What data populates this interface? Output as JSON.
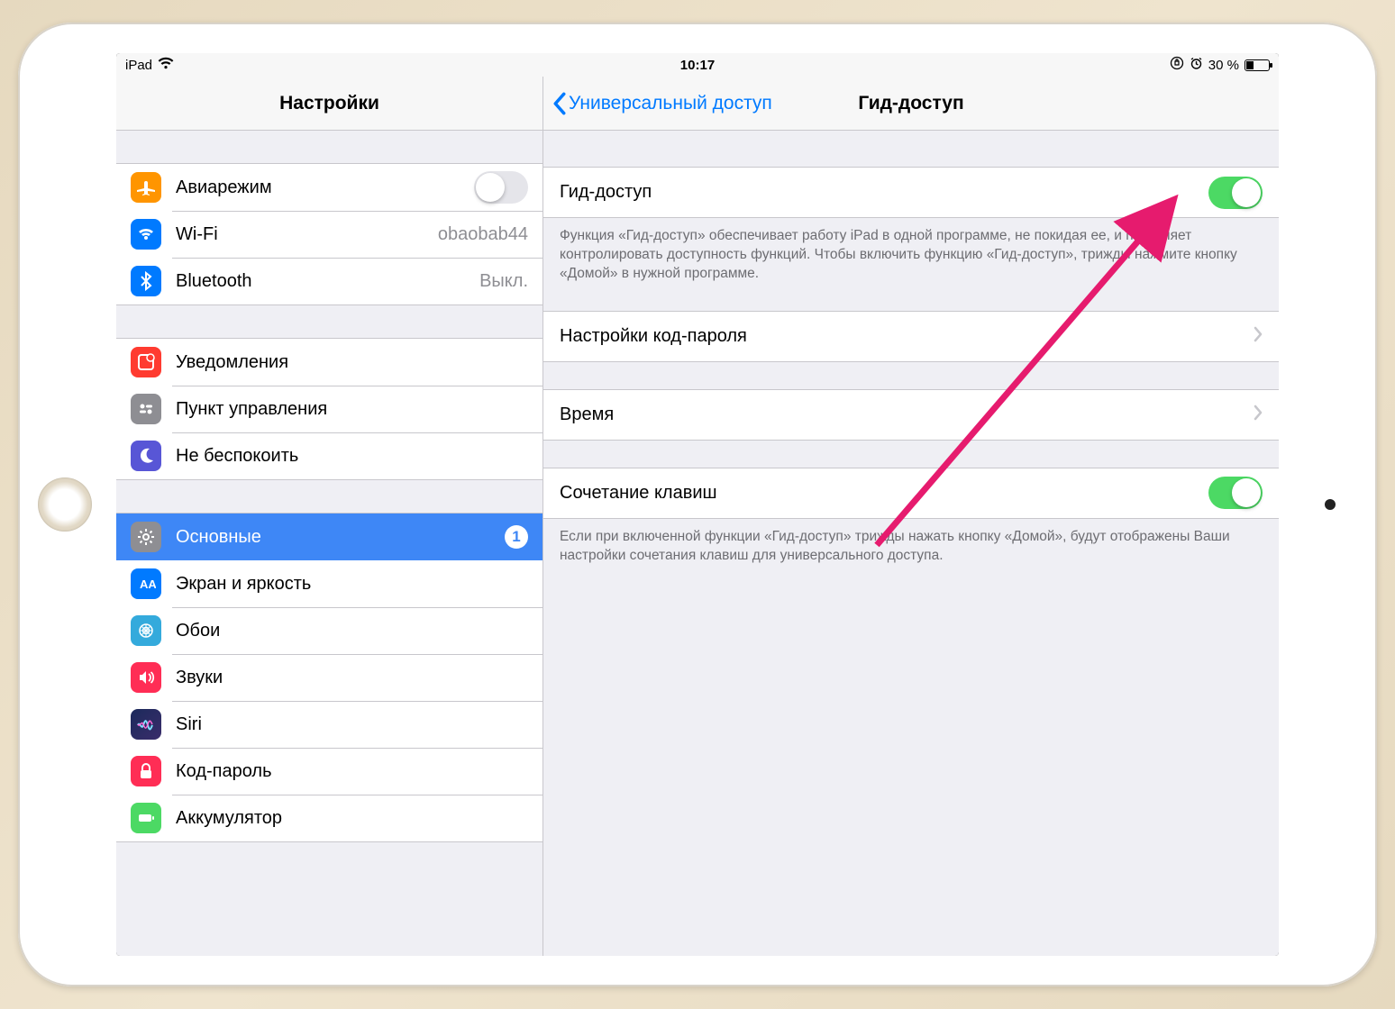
{
  "status": {
    "device": "iPad",
    "time": "10:17",
    "battery_text": "30 %"
  },
  "sidebar": {
    "title": "Настройки",
    "items": [
      {
        "label": "Авиарежим",
        "switch": false
      },
      {
        "label": "Wi-Fi",
        "value": "obaobab44"
      },
      {
        "label": "Bluetooth",
        "value": "Выкл."
      },
      {
        "label": "Уведомления"
      },
      {
        "label": "Пункт управления"
      },
      {
        "label": "Не беспокоить"
      },
      {
        "label": "Основные",
        "badge": "1",
        "selected": true
      },
      {
        "label": "Экран и яркость"
      },
      {
        "label": "Обои"
      },
      {
        "label": "Звуки"
      },
      {
        "label": "Siri"
      },
      {
        "label": "Код-пароль"
      },
      {
        "label": "Аккумулятор"
      }
    ]
  },
  "detail": {
    "back_label": "Универсальный доступ",
    "title": "Гид-доступ",
    "guided_access": {
      "label": "Гид-доступ",
      "on": true
    },
    "guided_note": "Функция «Гид-доступ» обеспечивает работу iPad в одной программе, не покидая ее, и позволяет контролировать доступность функций. Чтобы включить функцию «Гид-доступ», трижды нажмите кнопку «Домой» в нужной программе.",
    "passcode_row": "Настройки код-пароля",
    "time_row": "Время",
    "shortcut": {
      "label": "Сочетание клавиш",
      "on": true
    },
    "shortcut_note": "Если при включенной функции «Гид-доступ» трижды нажать кнопку «Домой», будут отображены Ваши настройки сочетания клавиш для универсального доступа."
  }
}
